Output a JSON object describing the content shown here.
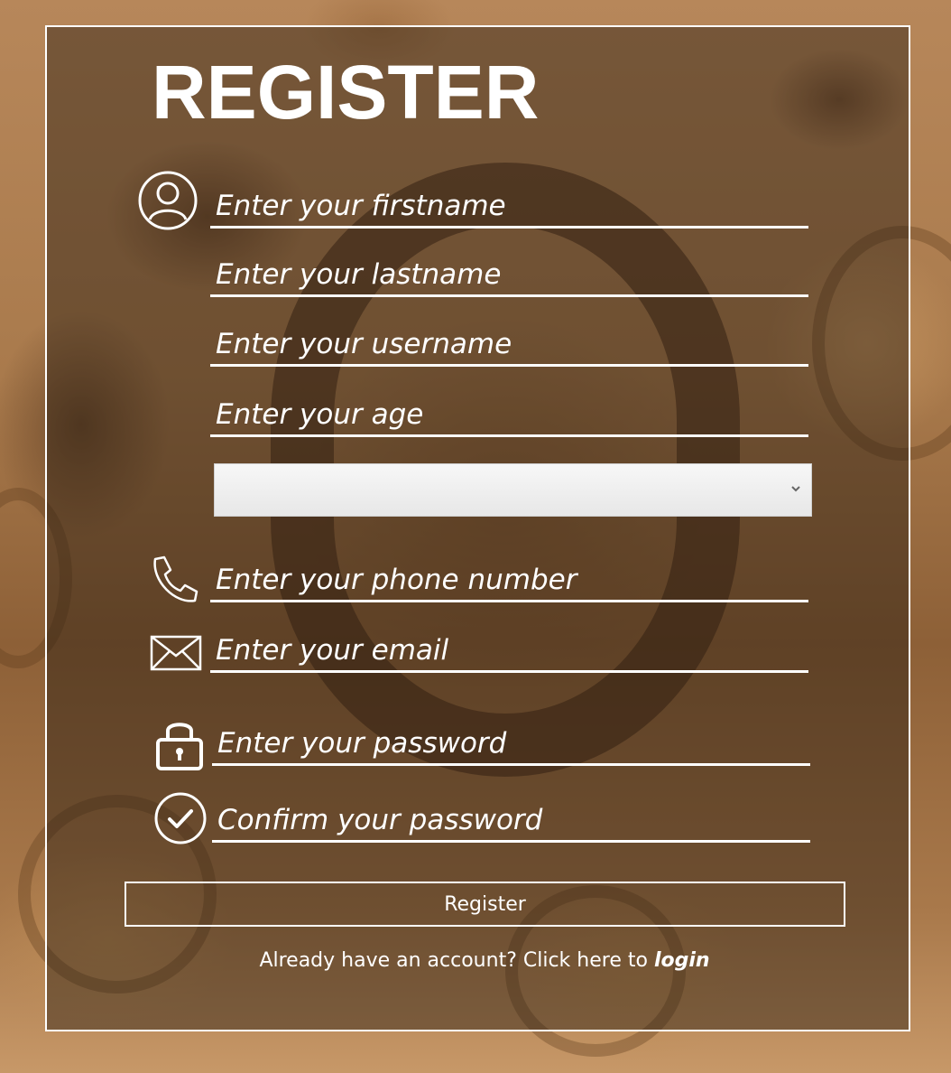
{
  "title": "REGISTER",
  "fields": {
    "firstname": {
      "placeholder": "Enter your firstname",
      "icon": "user-icon"
    },
    "lastname": {
      "placeholder": "Enter your lastname"
    },
    "username": {
      "placeholder": "Enter your username"
    },
    "age": {
      "placeholder": "Enter your age"
    },
    "gender_select": {
      "selected": ""
    },
    "phone": {
      "placeholder": "Enter your phone number",
      "icon": "phone-icon"
    },
    "email": {
      "placeholder": "Enter your email",
      "icon": "envelope-icon"
    },
    "password": {
      "placeholder": "Enter your password",
      "icon": "lock-icon"
    },
    "confirm_password": {
      "placeholder": "Confirm your password",
      "icon": "check-circle-icon"
    }
  },
  "register_button": {
    "label": "Register"
  },
  "footer": {
    "prompt": "Already have an account? Click here to ",
    "link_label": "login"
  },
  "colors": {
    "text": "#ffffff",
    "panel_border": "#ffffff",
    "select_background": "#ececec"
  }
}
